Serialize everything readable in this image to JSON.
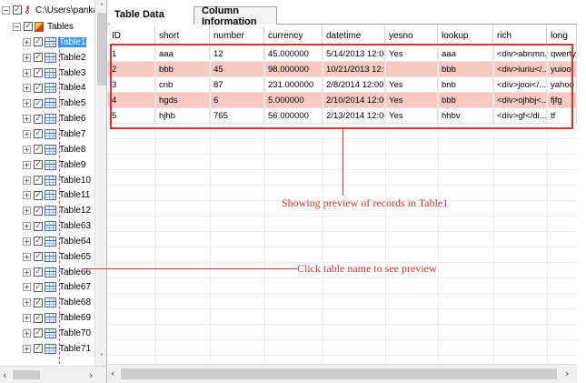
{
  "tree": {
    "root_label": "C:\\Users\\pankaj\\Desl",
    "tables_label": "Tables",
    "items": [
      "Table1",
      "Table2",
      "Table3",
      "Table4",
      "Table5",
      "Table6",
      "Table7",
      "Table8",
      "Table9",
      "Table10",
      "Table11",
      "Table12",
      "Table63",
      "Table64",
      "Table65",
      "Table66",
      "Table67",
      "Table68",
      "Table69",
      "Table70",
      "Table71"
    ],
    "selected": "Table1",
    "expand_glyph": "+",
    "collapse_glyph": "−",
    "check_glyph": "✓"
  },
  "tabs": {
    "table_data": "Table Data",
    "column_information": "Column Information"
  },
  "grid": {
    "columns": [
      "ID",
      "short",
      "number",
      "currency",
      "datetime",
      "yesno",
      "lookup",
      "rich",
      "long"
    ],
    "rows": [
      [
        "1",
        "aaa",
        "12",
        "45.000000",
        "5/14/2013 12:000...",
        "Yes",
        "aaa",
        "<div>abnmn...",
        "qwerty"
      ],
      [
        "2",
        "bbb",
        "45",
        "98.000000",
        "10/21/2013 12:0...",
        "",
        "bbb",
        "<div>iuriu</...",
        "yuioo"
      ],
      [
        "3",
        "cnb",
        "87",
        "231.000000",
        "2/8/2014 12:00:0...",
        "Yes",
        "bnb",
        "<div>jooi</...",
        "yahoo"
      ],
      [
        "4",
        "hgds",
        "6",
        "5.000000",
        "2/10/2014 12:00:...",
        "Yes",
        "bbb",
        "<div>ojhbj<...",
        "fjfg"
      ],
      [
        "5",
        "hjhb",
        "765",
        "56.000000",
        "2/13/2014 12:00:...",
        "Yes",
        "hhbv",
        "<div>gf</di...",
        "tf"
      ]
    ]
  },
  "annotations": {
    "records_preview": "Showing preview of records in Table1",
    "click_table": "Click table name to see preview",
    "color": "#e03030"
  },
  "colors": {
    "row_highlight": "#f6c9c2",
    "selection": "#3399ff"
  },
  "scroll": {
    "up": "˄",
    "down": "˅",
    "left": "‹",
    "right": "›"
  }
}
